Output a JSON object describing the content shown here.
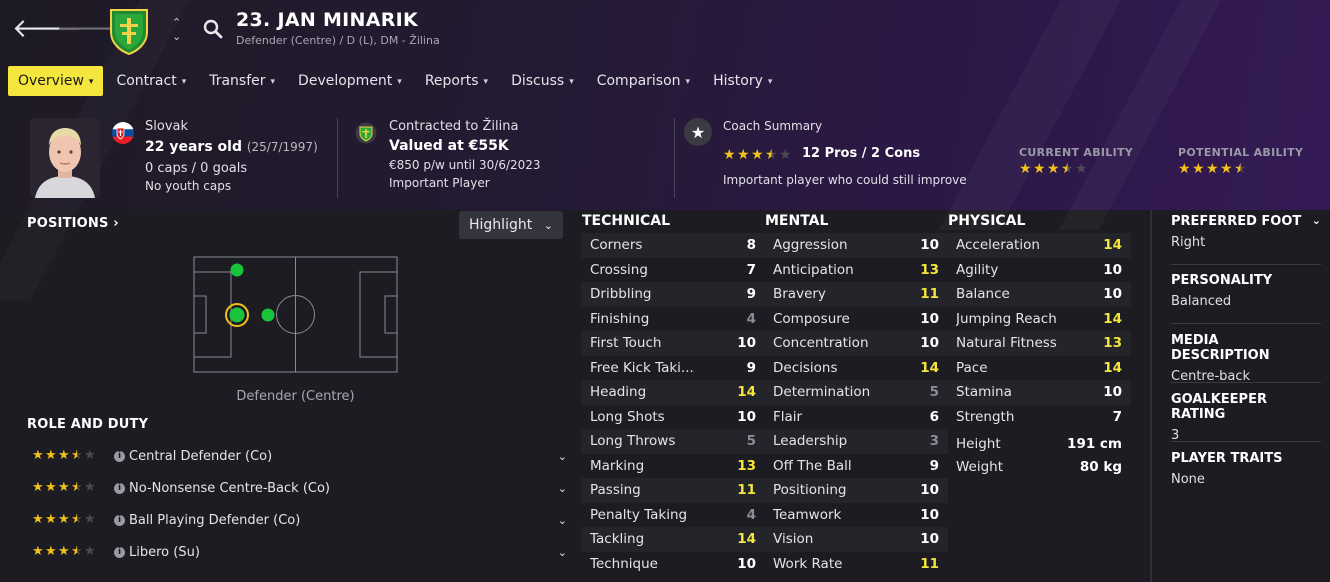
{
  "header": {
    "name": "23. JAN MINARIK",
    "subtitle": "Defender (Centre) / D (L), DM - Žilina"
  },
  "tabs": [
    {
      "label": "Overview",
      "active": true
    },
    {
      "label": "Contract"
    },
    {
      "label": "Transfer"
    },
    {
      "label": "Development"
    },
    {
      "label": "Reports"
    },
    {
      "label": "Discuss"
    },
    {
      "label": "Comparison"
    },
    {
      "label": "History"
    }
  ],
  "info": {
    "nationality": "Slovak",
    "age": "22 years old",
    "dob": "(25/7/1997)",
    "caps": "0 caps / 0 goals",
    "youth_caps": "No youth caps",
    "contract_label": "Contracted to Žilina",
    "value": "Valued at €55K",
    "wage": "€850 p/w until 30/6/2023",
    "status": "Important Player",
    "coach_label": "Coach Summary",
    "coach_rating": 3.5,
    "pros_cons": "12 Pros / 2 Cons",
    "coach_text": "Important player who could still improve",
    "ca_label": "CURRENT ABILITY",
    "ca_rating": 3.5,
    "pa_label": "POTENTIAL ABILITY",
    "pa_rating": 4.5
  },
  "positions": {
    "title": "POSITIONS",
    "highlight_label": "Highlight",
    "caption": "Defender (Centre)"
  },
  "roles": {
    "title": "ROLE AND DUTY",
    "items": [
      {
        "name": "Central Defender (Co)",
        "rating": 3.5
      },
      {
        "name": "No-Nonsense Centre-Back (Co)",
        "rating": 3.5
      },
      {
        "name": "Ball Playing Defender (Co)",
        "rating": 3.5
      },
      {
        "name": "Libero (Su)",
        "rating": 3.5
      }
    ]
  },
  "attributes": {
    "technical_title": "TECHNICAL",
    "mental_title": "MENTAL",
    "physical_title": "PHYSICAL",
    "technical": [
      {
        "name": "Corners",
        "value": "8"
      },
      {
        "name": "Crossing",
        "value": "7"
      },
      {
        "name": "Dribbling",
        "value": "9"
      },
      {
        "name": "Finishing",
        "value": "4"
      },
      {
        "name": "First Touch",
        "value": "10"
      },
      {
        "name": "Free Kick Taki...",
        "value": "9"
      },
      {
        "name": "Heading",
        "value": "14"
      },
      {
        "name": "Long Shots",
        "value": "10"
      },
      {
        "name": "Long Throws",
        "value": "5"
      },
      {
        "name": "Marking",
        "value": "13"
      },
      {
        "name": "Passing",
        "value": "11"
      },
      {
        "name": "Penalty Taking",
        "value": "4"
      },
      {
        "name": "Tackling",
        "value": "14"
      },
      {
        "name": "Technique",
        "value": "10"
      }
    ],
    "mental": [
      {
        "name": "Aggression",
        "value": "10"
      },
      {
        "name": "Anticipation",
        "value": "13"
      },
      {
        "name": "Bravery",
        "value": "11"
      },
      {
        "name": "Composure",
        "value": "10"
      },
      {
        "name": "Concentration",
        "value": "10"
      },
      {
        "name": "Decisions",
        "value": "14"
      },
      {
        "name": "Determination",
        "value": "5"
      },
      {
        "name": "Flair",
        "value": "6"
      },
      {
        "name": "Leadership",
        "value": "3"
      },
      {
        "name": "Off The Ball",
        "value": "9"
      },
      {
        "name": "Positioning",
        "value": "10"
      },
      {
        "name": "Teamwork",
        "value": "10"
      },
      {
        "name": "Vision",
        "value": "10"
      },
      {
        "name": "Work Rate",
        "value": "11"
      }
    ],
    "physical": [
      {
        "name": "Acceleration",
        "value": "14"
      },
      {
        "name": "Agility",
        "value": "10"
      },
      {
        "name": "Balance",
        "value": "10"
      },
      {
        "name": "Jumping Reach",
        "value": "14"
      },
      {
        "name": "Natural Fitness",
        "value": "13"
      },
      {
        "name": "Pace",
        "value": "14"
      },
      {
        "name": "Stamina",
        "value": "10"
      },
      {
        "name": "Strength",
        "value": "7"
      }
    ],
    "height_label": "Height",
    "height": "191 cm",
    "weight_label": "Weight",
    "weight": "80 kg"
  },
  "side": {
    "foot_title": "PREFERRED FOOT",
    "foot": "Right",
    "personality_title": "PERSONALITY",
    "personality": "Balanced",
    "media_title": "MEDIA DESCRIPTION",
    "media": "Centre-back",
    "gk_title": "GOALKEEPER RATING",
    "gk": "3",
    "traits_title": "PLAYER TRAITS",
    "traits": "None"
  },
  "colors": {
    "accent": "#f4e63c",
    "star": "#f2c21b",
    "high_value": "#f4e63c",
    "position_dot": "#19c43a"
  }
}
